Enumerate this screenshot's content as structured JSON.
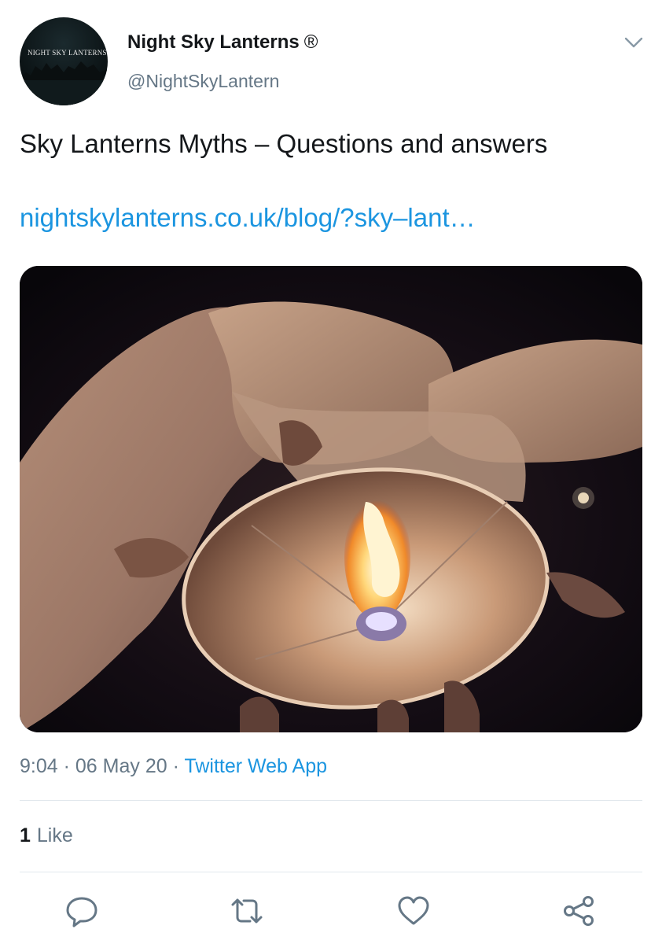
{
  "author": {
    "display_name": "Night Sky Lanterns",
    "verified_mark": "®",
    "handle": "@NightSkyLantern",
    "avatar_text": "NIGHT SKY LANTERNS"
  },
  "tweet": {
    "text": "Sky Lanterns Myths – Questions and answers",
    "link": "nightskylanterns.co.uk/blog/?sky–lant…",
    "time": "9:04",
    "date": "06 May 20",
    "separator": "·",
    "source": "Twitter Web App"
  },
  "stats": {
    "like_count": "1",
    "like_label": "Like"
  },
  "icons": {
    "menu": "chevron-down-icon",
    "reply": "reply-icon",
    "retweet": "retweet-icon",
    "like": "heart-icon",
    "share": "share-icon"
  },
  "colors": {
    "link": "#1b95e0",
    "secondary_text": "#657786",
    "primary_text": "#14171a",
    "divider": "#e1e8ed"
  }
}
